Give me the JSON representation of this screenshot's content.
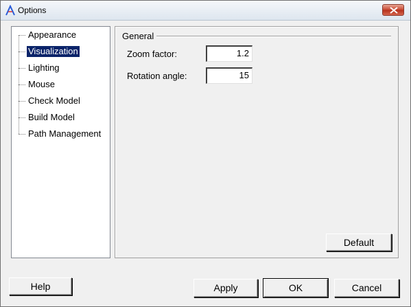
{
  "window": {
    "title": "Options"
  },
  "tree": {
    "items": [
      {
        "label": "Appearance",
        "selected": false
      },
      {
        "label": "Visualization",
        "selected": true
      },
      {
        "label": "Lighting",
        "selected": false
      },
      {
        "label": "Mouse",
        "selected": false
      },
      {
        "label": "Check Model",
        "selected": false
      },
      {
        "label": "Build Model",
        "selected": false
      },
      {
        "label": "Path Management",
        "selected": false
      }
    ]
  },
  "general": {
    "title": "General",
    "zoom_label": "Zoom factor:",
    "zoom_value": "1.2",
    "rotation_label": "Rotation angle:",
    "rotation_value": "15",
    "default_label": "Default"
  },
  "buttons": {
    "help": "Help",
    "apply": "Apply",
    "ok": "OK",
    "cancel": "Cancel"
  },
  "colors": {
    "selection": "#0a246a",
    "close": "#c7452f"
  }
}
